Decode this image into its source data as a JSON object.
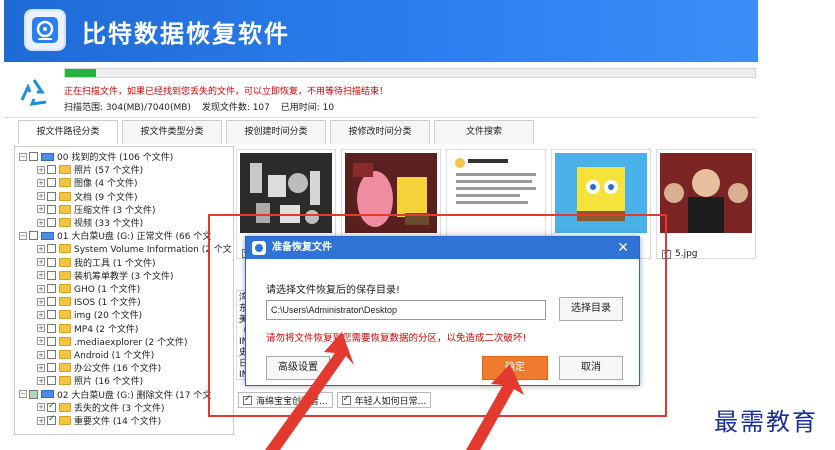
{
  "header": {
    "title": "比特数据恢复软件"
  },
  "scan": {
    "progress_fraction": 0.045,
    "message": "正在扫描文件，如果已经找到您丢失的文件，可以立即恢复，不用等待扫描结束！",
    "range_label": "扫描范围: 304(MB)/7040(MB)",
    "found_label": "发现文件数: 107",
    "time_label": "已用时间: 10"
  },
  "tabs": [
    "按文件路径分类",
    "按文件类型分类",
    "按创建时间分类",
    "按修改时间分类",
    "文件搜索"
  ],
  "tree": [
    {
      "label": "00 找到的文件  (106 个文件)",
      "level": 0,
      "icon": "drive"
    },
    {
      "label": "照片   (57 个文件)",
      "level": 1,
      "icon": "folder"
    },
    {
      "label": "图像   (4 个文件)",
      "level": 1,
      "icon": "folder"
    },
    {
      "label": "文档   (9 个文件)",
      "level": 1,
      "icon": "folder"
    },
    {
      "label": "压缩文件   (3 个文件)",
      "level": 1,
      "icon": "folder"
    },
    {
      "label": "视频   (33 个文件)",
      "level": 1,
      "icon": "folder"
    },
    {
      "label": "01 大白菜U盘 (G:) 正常文件 (66 个文",
      "level": 0,
      "icon": "drive"
    },
    {
      "label": "System Volume Information   (2 个文",
      "level": 1,
      "icon": "folder"
    },
    {
      "label": "我的工具   (1 个文件)",
      "level": 1,
      "icon": "folder"
    },
    {
      "label": "装机筹单教学   (3 个文件)",
      "level": 1,
      "icon": "folder"
    },
    {
      "label": "GHO   (1 个文件)",
      "level": 1,
      "icon": "folder"
    },
    {
      "label": "ISOS   (1 个文件)",
      "level": 1,
      "icon": "folder"
    },
    {
      "label": "img   (20 个文件)",
      "level": 1,
      "icon": "folder"
    },
    {
      "label": "MP4   (2 个文件)",
      "level": 1,
      "icon": "folder"
    },
    {
      "label": ".mediaexplorer   (2 个文件)",
      "level": 1,
      "icon": "folder"
    },
    {
      "label": "Android   (1 个文件)",
      "level": 1,
      "icon": "folder"
    },
    {
      "label": "办公文件   (16 个文件)",
      "level": 1,
      "icon": "folder"
    },
    {
      "label": "照片   (16 个文件)",
      "level": 1,
      "icon": "folder"
    },
    {
      "label": "02 大白菜U盘 (G:) 删除文件 (17 个文",
      "level": 0,
      "icon": "drive"
    },
    {
      "label": "丢失的文件   (3 个文件)",
      "level": 1,
      "icon": "folder"
    },
    {
      "label": "重要文件   (14 个文件)",
      "level": 1,
      "icon": "folder"
    }
  ],
  "thumbnails": [
    {
      "caption": "",
      "kind": "trophies"
    },
    {
      "caption": "",
      "kind": "patrick"
    },
    {
      "caption": "",
      "kind": "tweet"
    },
    {
      "caption": "",
      "kind": "spongebob"
    },
    {
      "caption": "5.jpg",
      "kind": "people"
    }
  ],
  "doc_preview_chars": "湾\n东\n美\n《\nIN\n史\n日\nIN\n日",
  "bottom_files": [
    "海绵宝宝创造者...",
    "年轻人如何日常..."
  ],
  "dialog": {
    "title": "准备恢复文件",
    "close": "✕",
    "prompt": "请选择文件恢复后的保存目录!",
    "path": "C:\\Users\\Administrator\\Desktop",
    "browse": "选择目录",
    "warning": "请勿将文件恢复到您需要恢复数据的分区，以免造成二次破坏!",
    "advanced": "高级设置",
    "ok": "确定",
    "cancel": "取消"
  },
  "watermark": "最需教育",
  "colors": {
    "header_blue": "#2c7ff0",
    "highlight_red": "#e23a2e",
    "ok_orange": "#f07b2e",
    "warn_red": "#d40000"
  }
}
